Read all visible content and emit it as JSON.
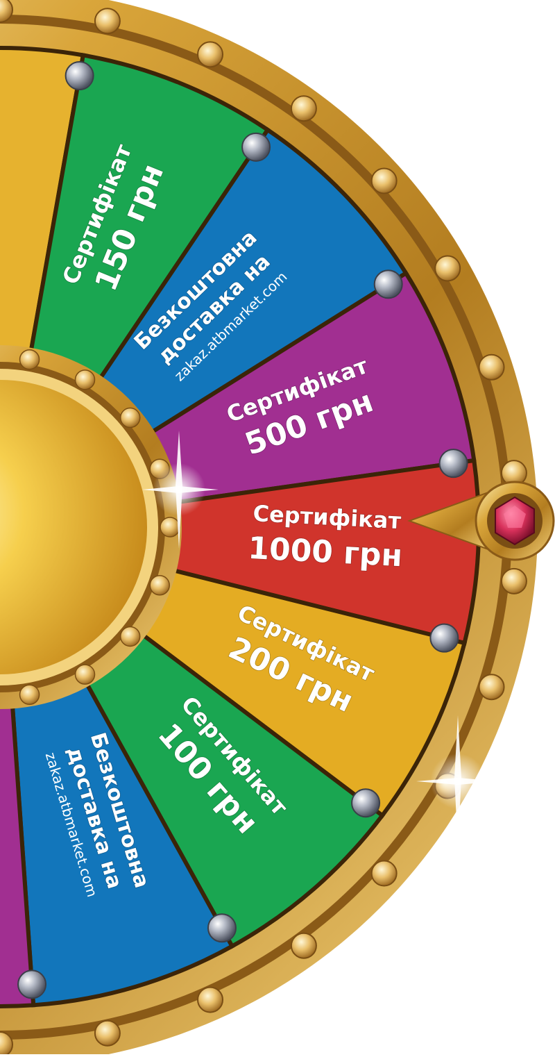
{
  "wheel": {
    "colors": {
      "gold": "#e7b23a",
      "gold_dark": "#a9761d",
      "gold_light": "#fbe9a3",
      "rim_outer": "#c99a36",
      "rim_inner": "#5a3a12",
      "hub": "#f6c946",
      "pointer_gem": "#d8315b",
      "stud": "#8f96a5"
    },
    "segments": [
      {
        "id": "gold-top",
        "color": "#e6b22f",
        "lines": []
      },
      {
        "id": "cert-150",
        "color": "#1aa651",
        "lines": [
          "Сертифікат",
          "150 грн"
        ]
      },
      {
        "id": "free-delivery-1",
        "color": "#1276bb",
        "lines": [
          "Безкоштовна",
          "доставка на",
          "zakaz.atbmarket.com"
        ]
      },
      {
        "id": "cert-500",
        "color": "#a12f91",
        "lines": [
          "Сертифікат",
          "500 грн"
        ]
      },
      {
        "id": "cert-1000",
        "color": "#d0342c",
        "lines": [
          "Сертифікат",
          "1000 грн"
        ]
      },
      {
        "id": "cert-200",
        "color": "#e4ac23",
        "lines": [
          "Сертифікат",
          "200 грн"
        ]
      },
      {
        "id": "cert-100",
        "color": "#1aa651",
        "lines": [
          "Сертифікат",
          "100 грн"
        ]
      },
      {
        "id": "free-delivery-2",
        "color": "#1276bb",
        "lines": [
          "Безкоштовна",
          "доставка на",
          "zakaz.atbmarket.com"
        ]
      },
      {
        "id": "purple-bottom",
        "color": "#a12f91",
        "lines": []
      }
    ],
    "pointer": {
      "icon": "ruby-gem-icon"
    }
  }
}
